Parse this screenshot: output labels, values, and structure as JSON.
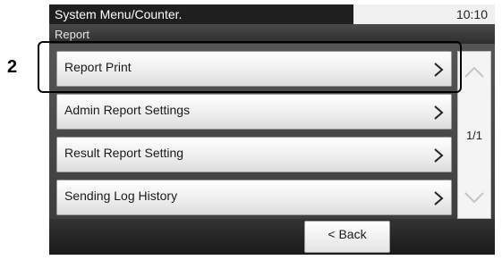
{
  "step": {
    "number": "2"
  },
  "header": {
    "title": "System Menu/Counter.",
    "time": "10:10",
    "subtitle": "Report"
  },
  "menu": {
    "items": [
      {
        "label": "Report Print",
        "icon": "chevron-right-icon",
        "highlighted": true
      },
      {
        "label": "Admin Report Settings",
        "icon": "chevron-right-icon",
        "highlighted": false
      },
      {
        "label": "Result Report Setting",
        "icon": "chevron-right-icon",
        "highlighted": false
      },
      {
        "label": "Sending Log History",
        "icon": "chevron-right-icon",
        "highlighted": false
      }
    ]
  },
  "scroll": {
    "page_indicator": "1/1",
    "up_icon": "chevron-up-icon",
    "down_icon": "chevron-down-icon",
    "up_enabled": false,
    "down_enabled": false
  },
  "footer": {
    "back_label": "< Back"
  },
  "colors": {
    "title_bar": "#1f1f1f",
    "highlight_frame": "#000000",
    "list_background": "#4a4a4a"
  }
}
